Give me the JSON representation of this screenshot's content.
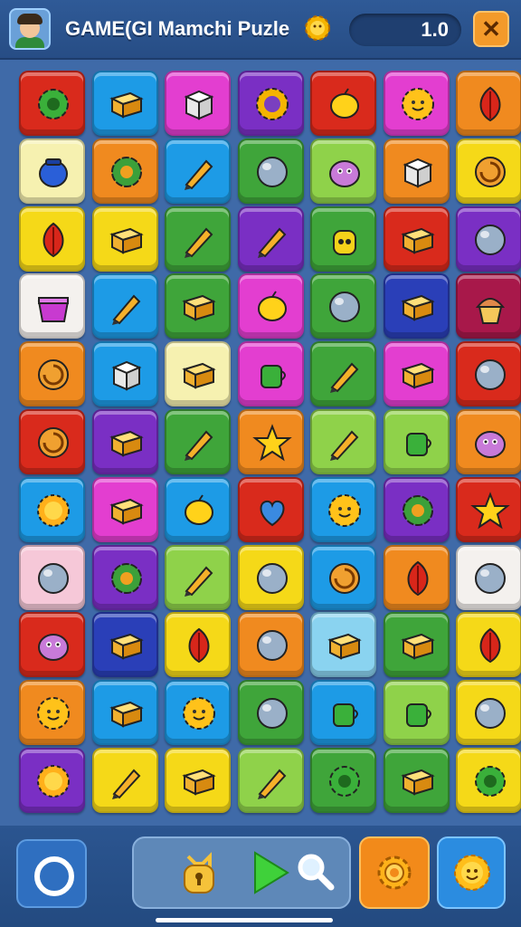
{
  "header": {
    "title": "GAME(GI Mamchi Puzle",
    "score": "1.0",
    "close_label": "✕"
  },
  "colors": {
    "red": "#d92a1c",
    "blue": "#1d9be6",
    "pink": "#e33ed0",
    "purple": "#7a2fc4",
    "orange": "#f08a1f",
    "yellow": "#f5d918",
    "green": "#3fa53a",
    "lightgreen": "#8fd24a",
    "lightyellow": "#f6f1b0",
    "white": "#f4f1ee",
    "lightpink": "#f6c8d8",
    "darkblue": "#2a3fb8",
    "lightblue": "#8ad3f0",
    "maroon": "#a8184a"
  },
  "board": {
    "rows": [
      [
        {
          "bg": "red",
          "icon": "gear-icon"
        },
        {
          "bg": "blue",
          "icon": "box-icon"
        },
        {
          "bg": "pink",
          "icon": "cube-icon"
        },
        {
          "bg": "purple",
          "icon": "sun-gear-icon"
        },
        {
          "bg": "red",
          "icon": "lemon-icon"
        },
        {
          "bg": "pink",
          "icon": "sun-face-icon"
        },
        {
          "bg": "orange",
          "icon": "leaf-icon"
        }
      ],
      [
        {
          "bg": "lightyellow",
          "icon": "jar-icon"
        },
        {
          "bg": "orange",
          "icon": "flower-icon"
        },
        {
          "bg": "blue",
          "icon": "pencil-icon"
        },
        {
          "bg": "green",
          "icon": "ball-icon"
        },
        {
          "bg": "lightgreen",
          "icon": "monster-icon"
        },
        {
          "bg": "orange",
          "icon": "cube-icon"
        },
        {
          "bg": "yellow",
          "icon": "swirl-icon"
        }
      ],
      [
        {
          "bg": "yellow",
          "icon": "leaf-icon"
        },
        {
          "bg": "yellow",
          "icon": "box-icon"
        },
        {
          "bg": "green",
          "icon": "pencil-icon"
        },
        {
          "bg": "purple",
          "icon": "pencil-icon"
        },
        {
          "bg": "green",
          "icon": "robot-icon"
        },
        {
          "bg": "red",
          "icon": "box-icon"
        },
        {
          "bg": "purple",
          "icon": "ball-icon"
        }
      ],
      [
        {
          "bg": "white",
          "icon": "basket-icon"
        },
        {
          "bg": "blue",
          "icon": "pencil-icon"
        },
        {
          "bg": "green",
          "icon": "box-icon"
        },
        {
          "bg": "pink",
          "icon": "lemon-icon"
        },
        {
          "bg": "green",
          "icon": "ball-icon"
        },
        {
          "bg": "darkblue",
          "icon": "box-icon"
        },
        {
          "bg": "maroon",
          "icon": "cupcake-icon"
        }
      ],
      [
        {
          "bg": "orange",
          "icon": "swirl-icon"
        },
        {
          "bg": "blue",
          "icon": "cube-icon"
        },
        {
          "bg": "lightyellow",
          "icon": "box-icon"
        },
        {
          "bg": "pink",
          "icon": "cup-icon"
        },
        {
          "bg": "green",
          "icon": "pencil-icon"
        },
        {
          "bg": "pink",
          "icon": "box-icon"
        },
        {
          "bg": "red",
          "icon": "ball-icon"
        }
      ],
      [
        {
          "bg": "red",
          "icon": "swirl-icon"
        },
        {
          "bg": "purple",
          "icon": "box-icon"
        },
        {
          "bg": "green",
          "icon": "pencil-icon"
        },
        {
          "bg": "orange",
          "icon": "star-icon"
        },
        {
          "bg": "lightgreen",
          "icon": "pencil-icon"
        },
        {
          "bg": "lightgreen",
          "icon": "cup-icon"
        },
        {
          "bg": "orange",
          "icon": "monster-icon"
        }
      ],
      [
        {
          "bg": "blue",
          "icon": "sun-icon"
        },
        {
          "bg": "pink",
          "icon": "box-icon"
        },
        {
          "bg": "blue",
          "icon": "lemon-icon"
        },
        {
          "bg": "red",
          "icon": "heart-icon"
        },
        {
          "bg": "blue",
          "icon": "sun-face-icon"
        },
        {
          "bg": "purple",
          "icon": "flower-icon"
        },
        {
          "bg": "red",
          "icon": "star-icon"
        }
      ],
      [
        {
          "bg": "lightpink",
          "icon": "ball-icon"
        },
        {
          "bg": "purple",
          "icon": "flower-icon"
        },
        {
          "bg": "lightgreen",
          "icon": "pencil-icon"
        },
        {
          "bg": "yellow",
          "icon": "ball-icon"
        },
        {
          "bg": "blue",
          "icon": "swirl-icon"
        },
        {
          "bg": "orange",
          "icon": "leaf-icon"
        },
        {
          "bg": "white",
          "icon": "ball-icon"
        }
      ],
      [
        {
          "bg": "red",
          "icon": "monster-icon"
        },
        {
          "bg": "darkblue",
          "icon": "box-icon"
        },
        {
          "bg": "yellow",
          "icon": "leaf-icon"
        },
        {
          "bg": "orange",
          "icon": "ball-icon"
        },
        {
          "bg": "lightblue",
          "icon": "box-icon"
        },
        {
          "bg": "green",
          "icon": "box-icon"
        },
        {
          "bg": "yellow",
          "icon": "leaf-icon"
        }
      ],
      [
        {
          "bg": "orange",
          "icon": "sun-face-icon"
        },
        {
          "bg": "blue",
          "icon": "box-icon"
        },
        {
          "bg": "blue",
          "icon": "sun-face-icon"
        },
        {
          "bg": "green",
          "icon": "ball-icon"
        },
        {
          "bg": "blue",
          "icon": "cup-icon"
        },
        {
          "bg": "lightgreen",
          "icon": "cup-icon"
        },
        {
          "bg": "yellow",
          "icon": "ball-icon"
        }
      ],
      [
        {
          "bg": "purple",
          "icon": "sun-icon"
        },
        {
          "bg": "yellow",
          "icon": "pencil-icon"
        },
        {
          "bg": "yellow",
          "icon": "box-icon"
        },
        {
          "bg": "lightgreen",
          "icon": "pencil-icon"
        },
        {
          "bg": "green",
          "icon": "gear-icon"
        },
        {
          "bg": "green",
          "icon": "box-icon"
        },
        {
          "bg": "yellow",
          "icon": "gear-icon"
        }
      ]
    ]
  },
  "footer": {
    "menu_icon": "ring-icon",
    "controls": [
      "padlock-icon",
      "play-icon",
      "search-icon"
    ],
    "settings_icon": "gear-icon",
    "sun_icon": "sun-face-icon"
  }
}
